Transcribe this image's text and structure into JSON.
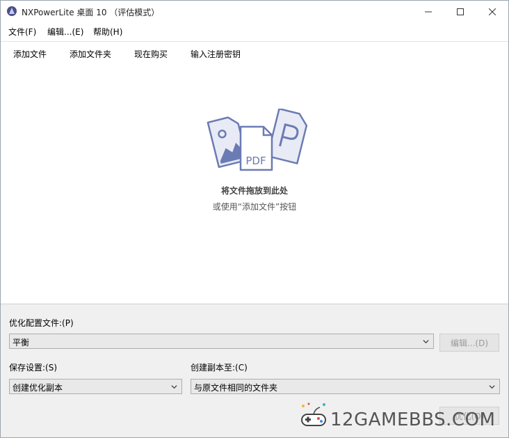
{
  "window": {
    "title": "NXPowerLite 桌面 10 （评估模式）",
    "controls": {
      "minimize": "minimize-icon",
      "maximize": "maximize-icon",
      "close": "close-icon"
    }
  },
  "menubar": {
    "items": [
      {
        "label": "文件(F)"
      },
      {
        "label": "编辑...(E)"
      },
      {
        "label": "帮助(H)"
      }
    ]
  },
  "toolbar": {
    "items": [
      {
        "label": "添加文件"
      },
      {
        "label": "添加文件夹"
      },
      {
        "label": "现在购买"
      },
      {
        "label": "输入注册密钥"
      }
    ]
  },
  "droparea": {
    "illustration_text": "PDF",
    "title": "将文件拖放到此处",
    "hint": "或使用“添加文件”按钮"
  },
  "settings": {
    "profile_label": "优化配置文件:(P)",
    "profile_value": "平衡",
    "edit_button": "编辑...(D)",
    "save_label": "保存设置:(S)",
    "save_value": "创建优化副本",
    "copy_to_label": "创建副本至:(C)",
    "copy_to_value": "与原文件相同的文件夹",
    "optimize_button": "优化(O)"
  },
  "watermark": {
    "text": "12GAMEBBS.COM"
  },
  "colors": {
    "illustration_stroke": "#6b7bb3",
    "illustration_fill": "#e8ebf5",
    "disabled_text": "#9a9a9a"
  }
}
